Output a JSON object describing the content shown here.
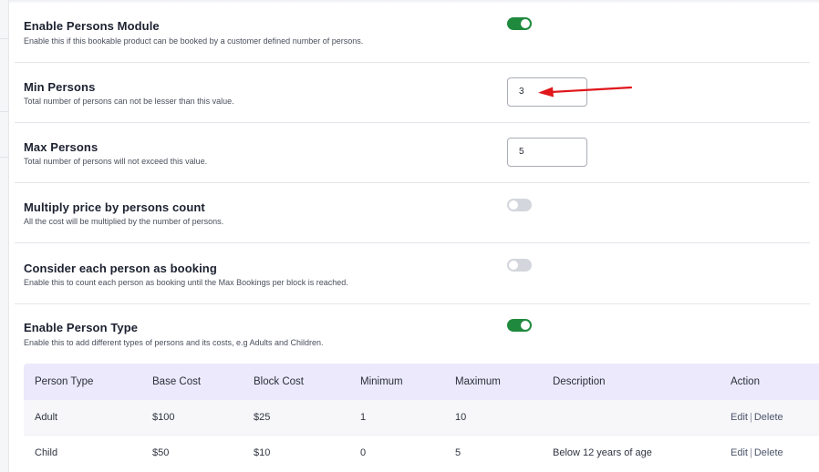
{
  "settings": {
    "persons_module": {
      "title": "Enable Persons Module",
      "description": "Enable this if this bookable product can be booked by a customer defined number of persons.",
      "enabled": true
    },
    "min_persons": {
      "title": "Min Persons",
      "description": "Total number of persons can not be lesser than this value.",
      "value": "3"
    },
    "max_persons": {
      "title": "Max Persons",
      "description": "Total number of persons will not exceed this value.",
      "value": "5"
    },
    "multiply_price": {
      "title": "Multiply price by persons count",
      "description": "All the cost will be multiplied by the number of persons.",
      "enabled": false
    },
    "person_as_booking": {
      "title": "Consider each person as booking",
      "description": "Enable this to count each person as booking until the Max Bookings per block is reached.",
      "enabled": false
    },
    "person_type": {
      "title": "Enable Person Type",
      "description": "Enable this to add different types of persons and its costs, e.g Adults and Children.",
      "enabled": true
    }
  },
  "person_table": {
    "headers": [
      "Person Type",
      "Base Cost",
      "Block Cost",
      "Minimum",
      "Maximum",
      "Description",
      "Action"
    ],
    "rows": [
      {
        "type": "Adult",
        "base_cost": "$100",
        "block_cost": "$25",
        "minimum": "1",
        "maximum": "10",
        "description": ""
      },
      {
        "type": "Child",
        "base_cost": "$50",
        "block_cost": "$10",
        "minimum": "0",
        "maximum": "5",
        "description": "Below 12 years of age"
      }
    ],
    "edit_label": "Edit",
    "separator": "|",
    "delete_label": "Delete"
  },
  "colors": {
    "toggle_on": "#1f8a3d",
    "toggle_off": "#d3d6dc",
    "table_header_bg": "#ebe9fb",
    "annotation_arrow": "#e0161b"
  },
  "icons": {
    "annotation": "red-arrow-icon"
  }
}
